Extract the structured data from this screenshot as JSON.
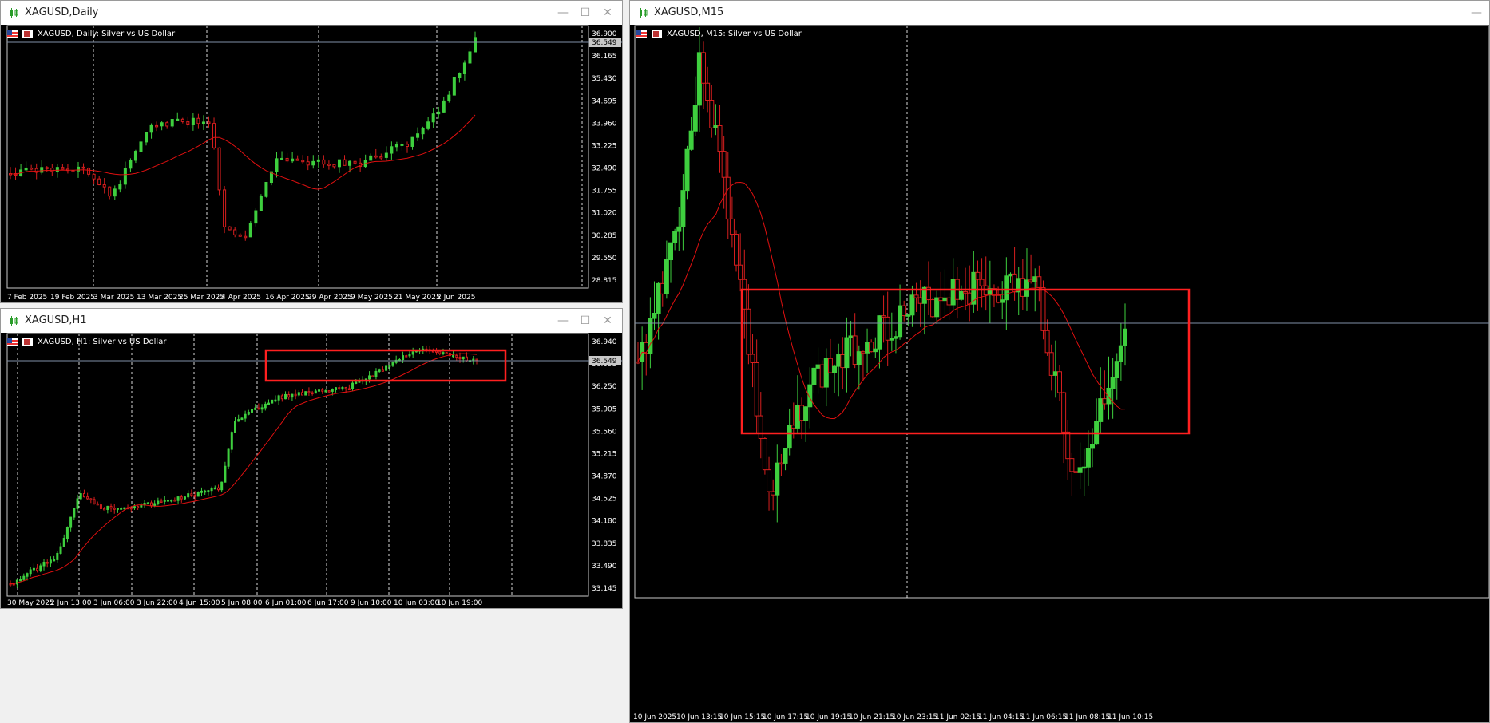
{
  "windows": {
    "daily": {
      "title": "XAGUSD,Daily",
      "header": "XAGUSD, Daily:  Silver vs US Dollar",
      "price_tag": "36.549",
      "y_ticks": [
        "36.900",
        "36.165",
        "35.430",
        "34.695",
        "33.960",
        "33.225",
        "32.490",
        "31.755",
        "31.020",
        "30.285",
        "29.550",
        "28.815"
      ],
      "x_ticks": [
        "7 Feb 2025",
        "19 Feb 2025",
        "3 Mar 2025",
        "13 Mar 2025",
        "25 Mar 2025",
        "4 Apr 2025",
        "16 Apr 2025",
        "29 Apr 2025",
        "9 May 2025",
        "21 May 2025",
        "2 Jun 2025"
      ]
    },
    "h1": {
      "title": "XAGUSD,H1",
      "header": "XAGUSD, H1:  Silver vs US Dollar",
      "price_tag": "36.549",
      "y_ticks": [
        "36.940",
        "36.595",
        "36.250",
        "35.905",
        "35.560",
        "35.215",
        "34.870",
        "34.525",
        "34.180",
        "33.835",
        "33.490",
        "33.145"
      ],
      "x_ticks": [
        "30 May 2025",
        "2 Jun 13:00",
        "3 Jun 06:00",
        "3 Jun 22:00",
        "4 Jun 15:00",
        "5 Jun 08:00",
        "6 Jun 01:00",
        "6 Jun 17:00",
        "9 Jun 10:00",
        "10 Jun 03:00",
        "10 Jun 19:00"
      ]
    },
    "m15": {
      "title": "XAGUSD,M15",
      "header": "XAGUSD, M15:  Silver vs US Dollar",
      "x_ticks": [
        "10 Jun 2025",
        "10 Jun 13:15",
        "10 Jun 15:15",
        "10 Jun 17:15",
        "10 Jun 19:15",
        "10 Jun 21:15",
        "10 Jun 23:15",
        "11 Jun 02:15",
        "11 Jun 04:15",
        "11 Jun 06:15",
        "11 Jun 08:15",
        "11 Jun 10:15"
      ]
    }
  },
  "controls": {
    "minimize": "—",
    "maximize": "☐",
    "close": "✕"
  },
  "colors": {
    "bull": "#3ecf3e",
    "bear": "#d81e1e",
    "ma": "#e01010",
    "grid": "#ffffff",
    "highlight_box": "#ff2020"
  },
  "icons": {
    "window": "chart-window-icon",
    "symbol": "flag-icon"
  }
}
